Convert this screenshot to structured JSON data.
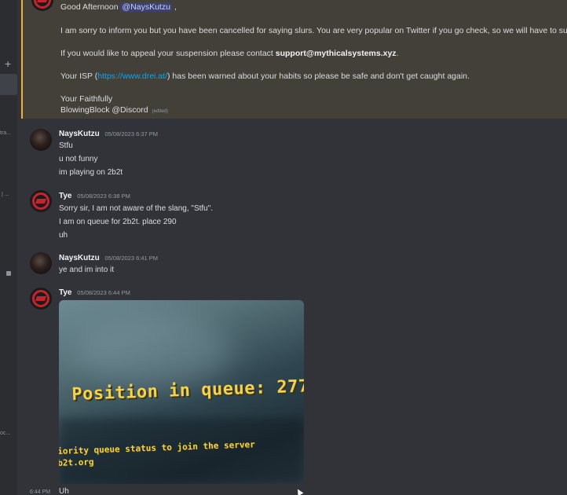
{
  "sidebar": {
    "plus": "+",
    "fragments": [
      "tra...",
      "| ...",
      "oc..."
    ]
  },
  "highlight_message": {
    "greeting_prefix": "Good Afternoon",
    "mention": "@NaysKutzu",
    "greeting_suffix": ",",
    "line2": "I am sorry to inform you but you have been cancelled for saying slurs. You are very popular on Twitter if you go check, so we will have to suspend",
    "line3_prefix": "If you would like to appeal your suspension please contact",
    "line3_email": "support@mythicalsystems.xyz",
    "line3_suffix": ".",
    "line4_prefix": "Your ISP (",
    "line4_link": "https://www.drei.at/",
    "line4_suffix": ") has been warned about your habits so please be safe and don't get caught again.",
    "signoff": "Your Faithfully",
    "signature": "BlowingBlock @Discord",
    "edited": "(edited)"
  },
  "messages": [
    {
      "author": "NaysKutzu",
      "time": "05/08/2023 6:37 PM",
      "lines": [
        "Stfu",
        "u not funny",
        "im playing on 2b2t"
      ]
    },
    {
      "author": "Tye",
      "time": "05/08/2023 6:38 PM",
      "lines": [
        "Sorry sir, I am not aware of the slang, \"Stfu\".",
        "I am on queue for 2b2t. place 290",
        "uh"
      ]
    },
    {
      "author": "NaysKutzu",
      "time": "05/08/2023 6:41 PM",
      "lines": [
        "ye and im into it"
      ]
    },
    {
      "author": "Tye",
      "time": "05/08/2023 6:44 PM",
      "lines": []
    }
  ],
  "attachment": {
    "text_main": "Position in queue: 277",
    "text_sub1": "iority queue status to join the server",
    "text_sub2": "b2t.org"
  },
  "bottom": {
    "time": "6:44 PM",
    "text": "Uh"
  },
  "colors": {
    "background": "#313338",
    "highlight_bg": "#433f39",
    "highlight_bar": "#f0b132",
    "link": "#00a8fc",
    "mention_bg": "#3c4270",
    "queue_text": "#f5d24a"
  }
}
